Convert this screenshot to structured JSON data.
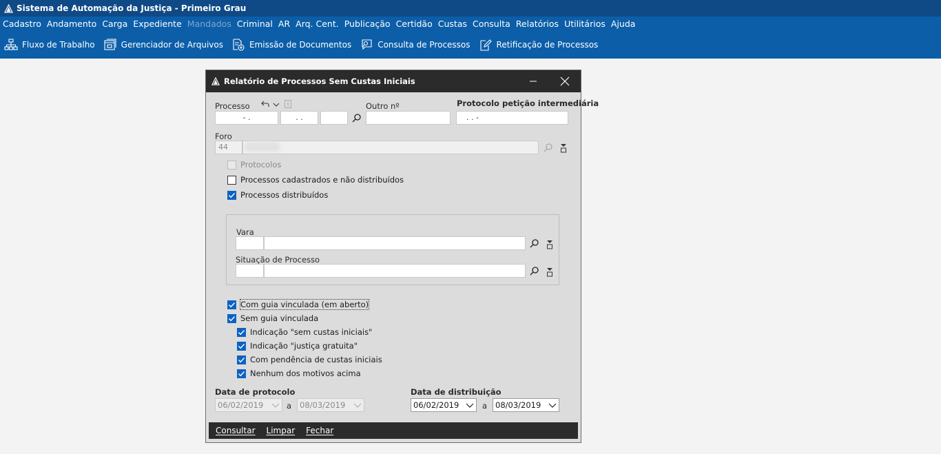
{
  "app": {
    "title": "Sistema de Automação da Justiça - Primeiro Grau"
  },
  "menu": [
    {
      "label": "Cadastro",
      "enabled": true
    },
    {
      "label": "Andamento",
      "enabled": true
    },
    {
      "label": "Carga",
      "enabled": true
    },
    {
      "label": "Expediente",
      "enabled": true
    },
    {
      "label": "Mandados",
      "enabled": false
    },
    {
      "label": "Criminal",
      "enabled": true
    },
    {
      "label": "AR",
      "enabled": true
    },
    {
      "label": "Arq. Cent.",
      "enabled": true
    },
    {
      "label": "Publicação",
      "enabled": true
    },
    {
      "label": "Certidão",
      "enabled": true
    },
    {
      "label": "Custas",
      "enabled": true
    },
    {
      "label": "Consulta",
      "enabled": true
    },
    {
      "label": "Relatórios",
      "enabled": true
    },
    {
      "label": "Utilitários",
      "enabled": true
    },
    {
      "label": "Ajuda",
      "enabled": true
    }
  ],
  "toolbar": [
    {
      "label": "Fluxo de Trabalho",
      "icon": "flowchart-icon"
    },
    {
      "label": "Gerenciador de Arquivos",
      "icon": "file-manager-icon"
    },
    {
      "label": "Emissão de Documentos",
      "icon": "document-add-icon"
    },
    {
      "label": "Consulta de Processos",
      "icon": "search-chat-icon"
    },
    {
      "label": "Retificação de Processos",
      "icon": "edit-document-icon"
    }
  ],
  "dialog": {
    "title": "Relatório de Processos Sem Custas Iniciais",
    "processo_label": "Processo",
    "processo_part1": "-  .",
    "processo_part2": ".  .",
    "processo_part3": "",
    "outro_label": "Outro nº",
    "outro_value": "",
    "protocolo_label": "Protocolo petição intermediária",
    "protocolo_value": ".  .         -",
    "foro_label": "Foro",
    "foro_code": "44",
    "foro_name": "",
    "checks": {
      "protocolos": {
        "label": "Protocolos",
        "checked": false,
        "enabled": false
      },
      "cadastrados": {
        "label": "Processos cadastrados e não distribuídos",
        "checked": false,
        "enabled": true
      },
      "distribuidos": {
        "label": "Processos distribuídos",
        "checked": true,
        "enabled": true
      }
    },
    "vara_label": "Vara",
    "situacao_label": "Situação de Processo",
    "guia": {
      "com_guia": {
        "label": "Com guia vinculada (em aberto)",
        "checked": true
      },
      "sem_guia": {
        "label": "Sem guia vinculada",
        "checked": true
      },
      "sem_custas": {
        "label": "Indicação \"sem custas iniciais\"",
        "checked": true
      },
      "justica_gratuita": {
        "label": "Indicação \"justiça gratuita\"",
        "checked": true
      },
      "pendencia": {
        "label": "Com pendência de custas iniciais",
        "checked": true
      },
      "nenhum": {
        "label": "Nenhum dos motivos acima",
        "checked": true
      }
    },
    "data_protocolo_label": "Data de protocolo",
    "data_protocolo_from": "06/02/2019",
    "data_protocolo_to": "08/03/2019",
    "data_distribuicao_label": "Data de distribuição",
    "data_distribuicao_from": "06/02/2019",
    "data_distribuicao_to": "08/03/2019",
    "sep_a": "a",
    "footer": {
      "consultar": "Consultar",
      "limpar": "Limpar",
      "fechar": "Fechar"
    }
  },
  "colors": {
    "title_bg": "#0f4a86",
    "menu_bg": "#0c5ea8",
    "checkbox_accent": "#0b62c4",
    "dialog_bar": "#2b2b2b"
  }
}
